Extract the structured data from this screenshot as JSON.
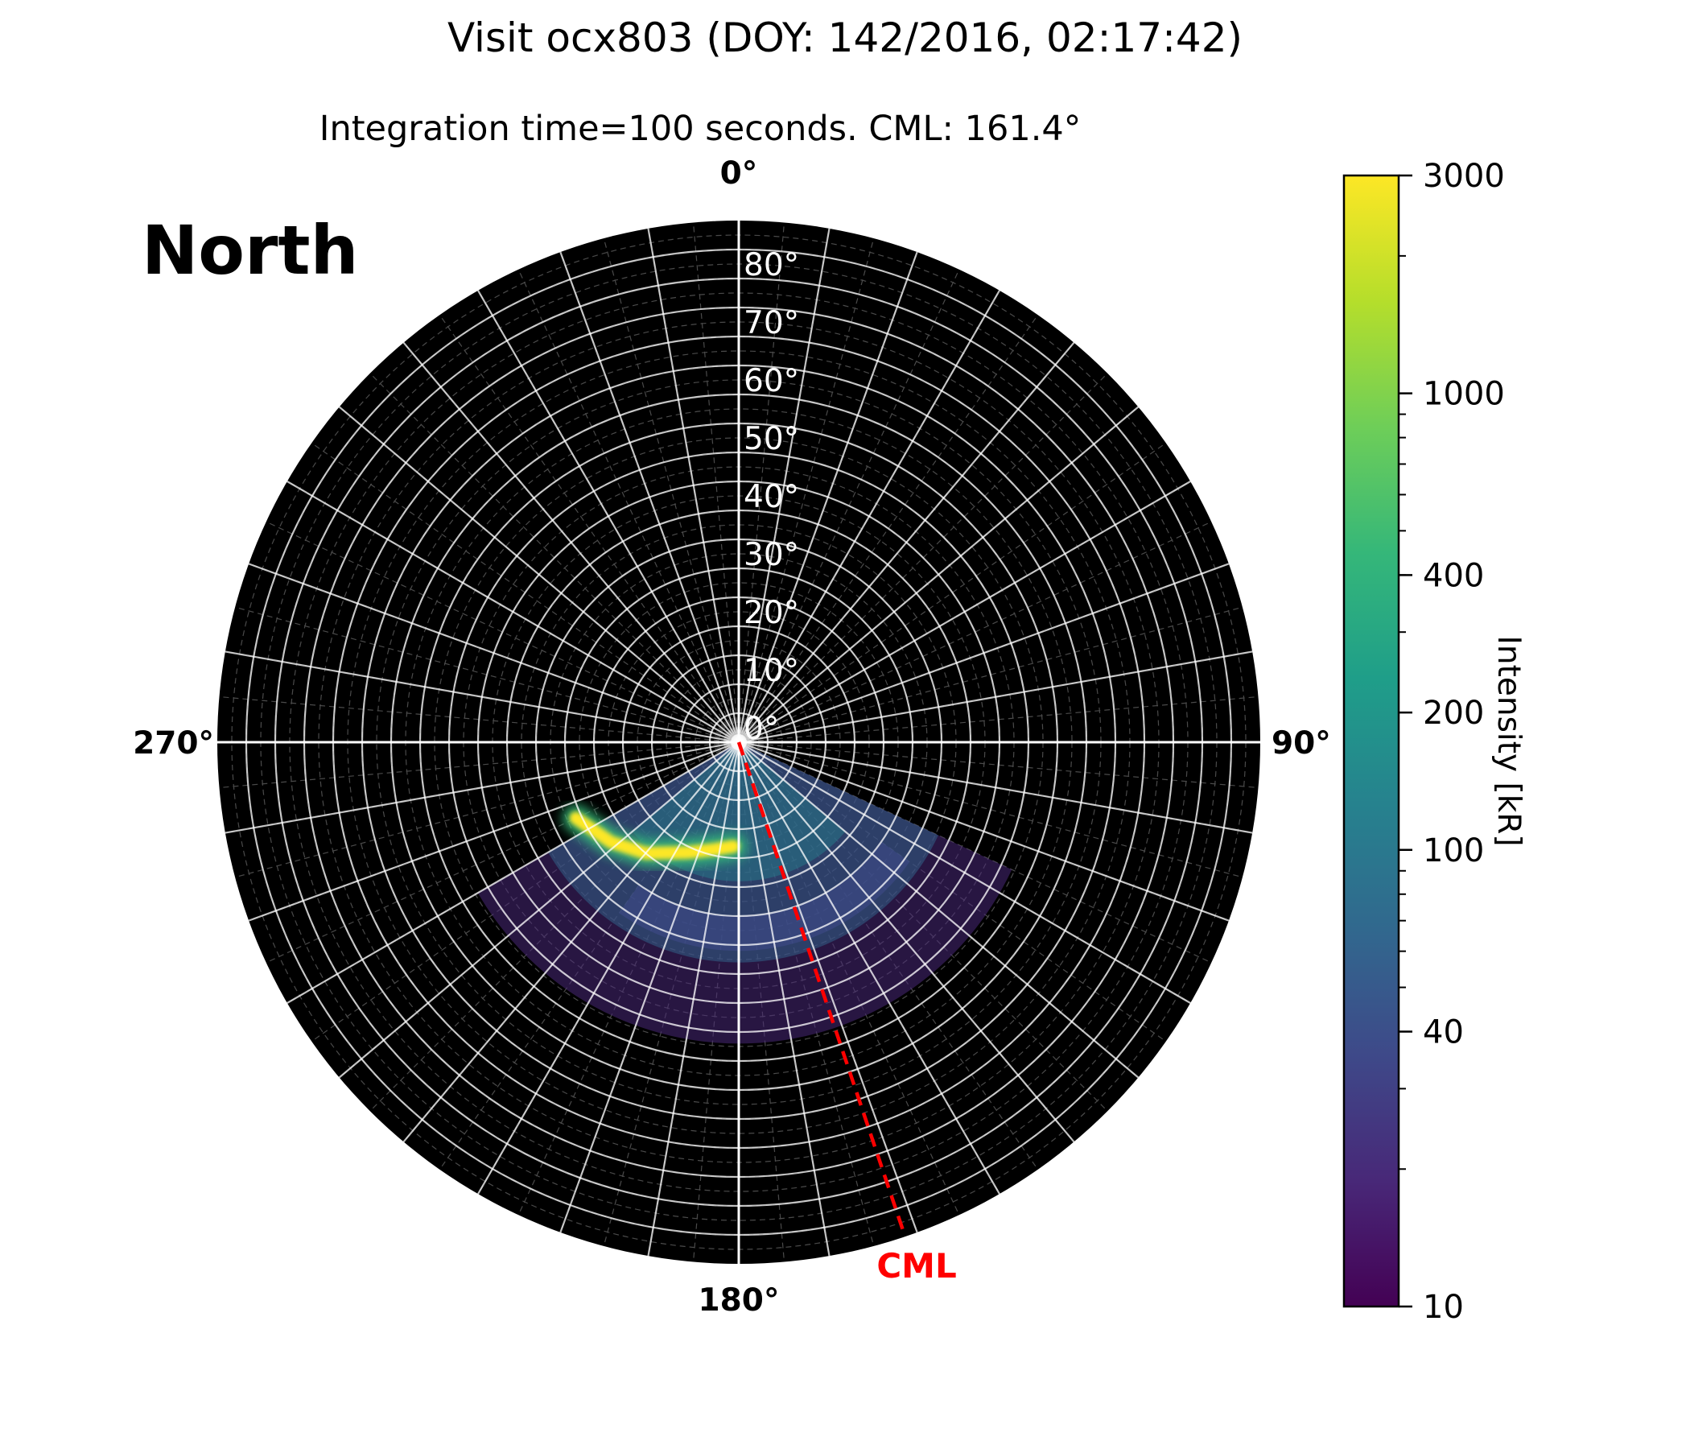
{
  "title": "Visit ocx803 (DOY: 142/2016, 02:17:42)",
  "subtitle": "Integration time=100 seconds. CML: 161.4°",
  "hemisphere": "North",
  "chart_data": {
    "type": "heatmap",
    "projection": "polar",
    "title": "Visit ocx803 (DOY: 142/2016, 02:17:42)",
    "subtitle": "Integration time=100 seconds. CML: 161.4°",
    "hemisphere": "North",
    "angular_ticks": [
      {
        "angle": 0,
        "label": "0°"
      },
      {
        "angle": 90,
        "label": "90°"
      },
      {
        "angle": 180,
        "label": "180°"
      },
      {
        "angle": 270,
        "label": "270°"
      }
    ],
    "angular_direction": "clockwise",
    "angular_zero": "top",
    "radial_ticks": [
      {
        "value": 0,
        "label": "0°"
      },
      {
        "value": 10,
        "label": "10°"
      },
      {
        "value": 20,
        "label": "20°"
      },
      {
        "value": 30,
        "label": "30°"
      },
      {
        "value": 40,
        "label": "40°"
      },
      {
        "value": 50,
        "label": "50°"
      },
      {
        "value": 60,
        "label": "60°"
      },
      {
        "value": 70,
        "label": "70°"
      },
      {
        "value": 80,
        "label": "80°"
      }
    ],
    "radial_max": 90,
    "cml": {
      "angle": 161.4,
      "label": "CML",
      "color": "#ff0000",
      "style": "dashed"
    },
    "colorbar": {
      "label": "Intensity [kR]",
      "scale": "log",
      "range": [
        10,
        3000
      ],
      "ticks": [
        {
          "value": 10,
          "label": "10"
        },
        {
          "value": 40,
          "label": "40"
        },
        {
          "value": 100,
          "label": "100"
        },
        {
          "value": 200,
          "label": "200"
        },
        {
          "value": 400,
          "label": "400"
        },
        {
          "value": 1000,
          "label": "1000"
        },
        {
          "value": 3000,
          "label": "3000"
        }
      ],
      "colormap": "viridis",
      "colors": [
        "#440154",
        "#482878",
        "#3e4989",
        "#31688e",
        "#26828e",
        "#1f9e89",
        "#35b779",
        "#6ece58",
        "#b5de2b",
        "#fde725"
      ]
    },
    "emission": {
      "visible_longitude_range": [
        115,
        240
      ],
      "main_oval": {
        "intensity_max": 3000,
        "points": [
          {
            "lon": 245,
            "colat": 31
          },
          {
            "lon": 232,
            "colat": 28
          },
          {
            "lon": 220,
            "colat": 25
          },
          {
            "lon": 205,
            "colat": 21
          },
          {
            "lon": 193,
            "colat": 19
          },
          {
            "lon": 183,
            "colat": 18
          }
        ]
      }
    },
    "background_color": "#000000",
    "grid": true
  }
}
